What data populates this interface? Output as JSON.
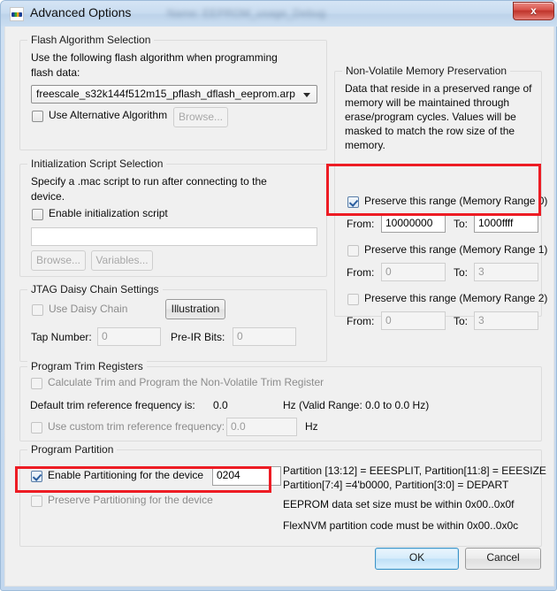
{
  "window": {
    "title": "Advanced Options",
    "blurred_subtitle": "Name:  EEPROM_usage_Debug",
    "icon": "nxp-logo-icon",
    "close_label": "x"
  },
  "flash_algorithm": {
    "legend": "Flash Algorithm Selection",
    "description_line1": "Use the following flash algorithm when programming",
    "description_line2": "flash data:",
    "combo_value": "freescale_s32k144f512m15_pflash_dflash_eeprom.arp",
    "alt_checkbox_label": "Use Alternative Algorithm",
    "alt_checkbox_checked": false,
    "browse_label": "Browse..."
  },
  "init_script": {
    "legend": "Initialization Script Selection",
    "description_line1": "Specify a .mac script to run after connecting to the",
    "description_line2": "device.",
    "enable_label": "Enable initialization script",
    "enable_checked": false,
    "path_value": "",
    "browse_label": "Browse...",
    "variables_label": "Variables..."
  },
  "jtag": {
    "legend": "JTAG Daisy Chain Settings",
    "use_daisy_chain_label": "Use Daisy Chain",
    "use_daisy_chain_checked": false,
    "illustration_label": "Illustration",
    "tap_number_label": "Tap Number:",
    "tap_number_value": "0",
    "pre_ir_bits_label": "Pre-IR Bits:",
    "pre_ir_bits_value": "0"
  },
  "nvm": {
    "legend": "Non-Volatile Memory Preservation",
    "description": [
      "Data that reside in a preserved range of",
      "memory will be maintained through",
      "erase/program cycles. Values will be",
      "masked to match the row size of the",
      "memory."
    ],
    "from_label": "From:",
    "to_label": "To:",
    "ranges": [
      {
        "checkbox_label": "Preserve this range (Memory Range 0)",
        "checked": true,
        "from_value": "10000000",
        "to_value": "1000ffff",
        "highlighted": true
      },
      {
        "checkbox_label": "Preserve this range (Memory Range 1)",
        "checked": false,
        "from_value": "0",
        "to_value": "3",
        "highlighted": false
      },
      {
        "checkbox_label": "Preserve this range (Memory Range 2)",
        "checked": false,
        "from_value": "0",
        "to_value": "3",
        "highlighted": false
      }
    ]
  },
  "trim": {
    "legend": "Program Trim Registers",
    "calculate_label": "Calculate Trim and Program the Non-Volatile Trim Register",
    "calculate_checked": false,
    "default_freq_label": "Default trim reference frequency is:",
    "default_freq_value": "0.0",
    "default_freq_unit": "Hz (Valid Range: 0.0 to 0.0 Hz)",
    "custom_freq_label": "Use custom trim reference frequency:",
    "custom_freq_checked": false,
    "custom_freq_value": "0.0",
    "custom_freq_unit": "Hz"
  },
  "partition": {
    "legend": "Program Partition",
    "enable_label": "Enable Partitioning for the device",
    "enable_checked": true,
    "enable_value": "0204",
    "preserve_label": "Preserve Partitioning for the device",
    "preserve_checked": false,
    "notes": [
      "Partition [13:12] = EEESPLIT, Partition[11:8] = EEESIZE",
      "Partition[7:4] =4'b0000, Partition[3:0] = DEPART",
      "EEPROM data set size must be within 0x00..0x0f",
      "FlexNVM partition code must be within 0x00..0x0c"
    ]
  },
  "footer": {
    "ok_label": "OK",
    "cancel_label": "Cancel"
  },
  "colors": {
    "highlight": "#ed1c24",
    "dialog_bg": "#f0f0f0",
    "titlebar": "#c9dcf0"
  }
}
